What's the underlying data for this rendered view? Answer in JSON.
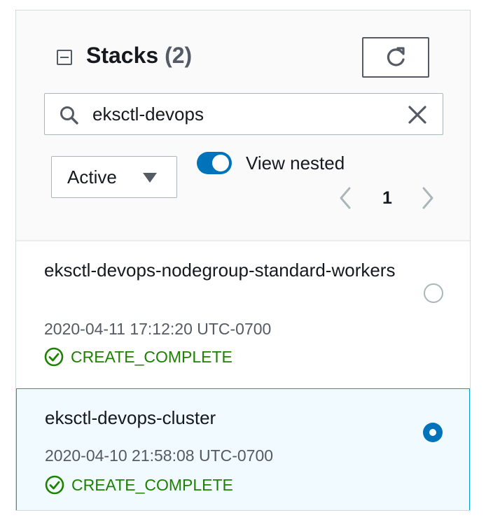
{
  "header": {
    "title": "Stacks",
    "count": "(2)",
    "refresh_icon": "refresh-icon",
    "collapse_icon": "collapse-icon"
  },
  "search": {
    "value": "eksctl-devops",
    "icon": "search-icon",
    "clear_icon": "close-icon"
  },
  "filter": {
    "selected": "Active"
  },
  "view_nested": {
    "label": "View nested",
    "enabled": true
  },
  "pagination": {
    "current_page": "1"
  },
  "stacks": [
    {
      "name": "eksctl-devops-nodegroup-standard-workers",
      "timestamp": "2020-04-11 17:12:20 UTC-0700",
      "status": "CREATE_COMPLETE",
      "selected": false
    },
    {
      "name": "eksctl-devops-cluster",
      "timestamp": "2020-04-10 21:58:08 UTC-0700",
      "status": "CREATE_COMPLETE",
      "selected": true
    }
  ],
  "colors": {
    "accent": "#0073bb",
    "success": "#1d8102",
    "selected_row_bg": "#f1faff",
    "selected_row_border": "#00a1c9"
  }
}
